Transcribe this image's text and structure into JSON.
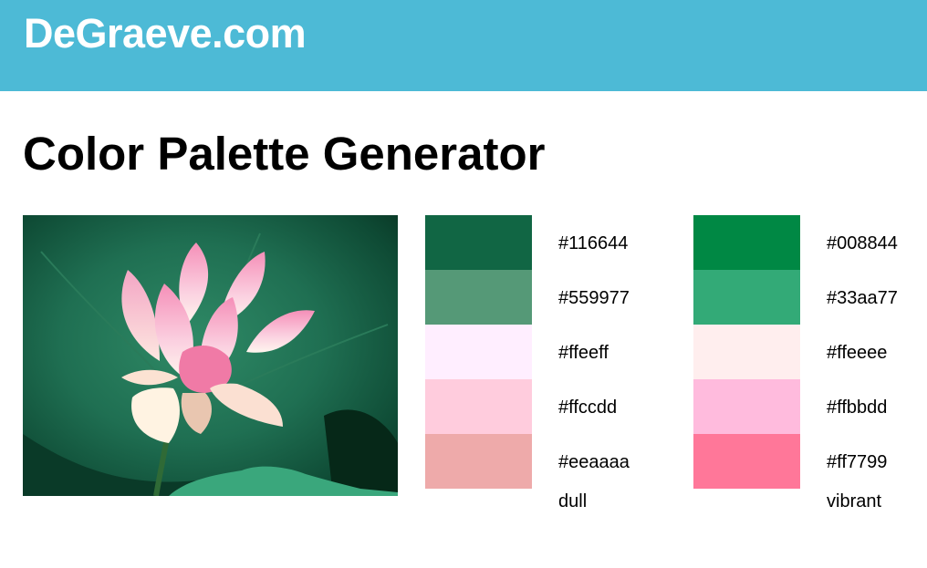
{
  "header": {
    "site_title": "DeGraeve.com",
    "background": "#4dbad6"
  },
  "page": {
    "title": "Color Palette Generator"
  },
  "photo": {
    "subject": "pink lotus flower on green leaf"
  },
  "palettes": {
    "dull": {
      "label": "dull",
      "swatches": [
        {
          "hex": "#116644",
          "label": "#116644"
        },
        {
          "hex": "#559977",
          "label": "#559977"
        },
        {
          "hex": "#ffeeff",
          "label": "#ffeeff"
        },
        {
          "hex": "#ffccdd",
          "label": "#ffccdd"
        },
        {
          "hex": "#eeaaaa",
          "label": "#eeaaaa"
        }
      ]
    },
    "vibrant": {
      "label": "vibrant",
      "swatches": [
        {
          "hex": "#008844",
          "label": "#008844"
        },
        {
          "hex": "#33aa77",
          "label": "#33aa77"
        },
        {
          "hex": "#ffeeee",
          "label": "#ffeeee"
        },
        {
          "hex": "#ffbbdd",
          "label": "#ffbbdd"
        },
        {
          "hex": "#ff7799",
          "label": "#ff7799"
        }
      ]
    }
  }
}
